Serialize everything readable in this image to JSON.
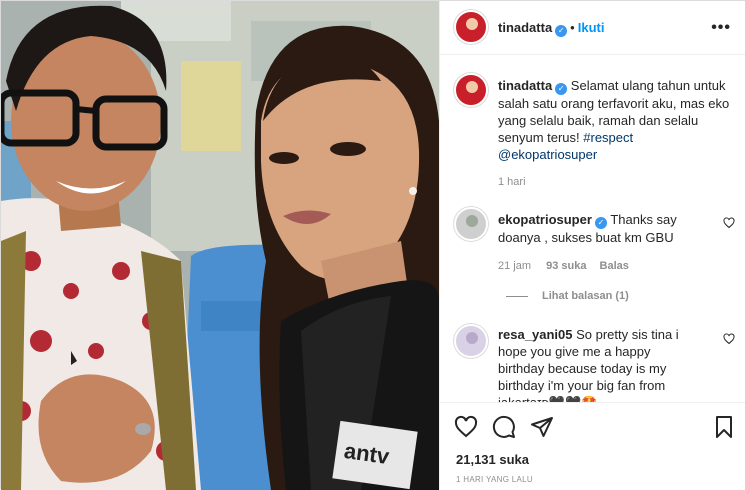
{
  "post": {
    "author": "tinadatta",
    "follow_label": "Ikuti",
    "dot": "•",
    "more": "•••"
  },
  "photo": {
    "logo_text": "antv"
  },
  "caption": {
    "username": "tinadatta",
    "text": "Selamat ulang tahun untuk salah satu orang terfavorit aku, mas eko yang selalu baik, ramah dan selalu senyum terus! ",
    "hashtag": "#respect",
    "mention": "@ekopatriosuper",
    "time": "1 hari"
  },
  "comments": [
    {
      "username": "ekopatriosuper",
      "verified": true,
      "text": "Thanks say doanya , sukses buat km GBU",
      "time": "21 jam",
      "likes": "93 suka",
      "reply": "Balas",
      "view_replies": "Lihat balasan (1)"
    },
    {
      "username": "resa_yani05",
      "verified": false,
      "text": "So pretty sis tina i hope you give me a happy birthday because today is my birthday i'm your big fan from jakartaɪᴅ🖤🖤🤩"
    }
  ],
  "footer": {
    "likes": "21,131 suka",
    "time_ago": "1 HARI YANG LALU"
  },
  "icons": {
    "like": "heart-icon",
    "comment": "comment-icon",
    "share": "share-icon",
    "save": "bookmark-icon",
    "comment_like": "heart-icon"
  },
  "colors": {
    "link_blue": "#0095f6",
    "verified_blue": "#3897f0",
    "muted": "#8e8e8e"
  }
}
